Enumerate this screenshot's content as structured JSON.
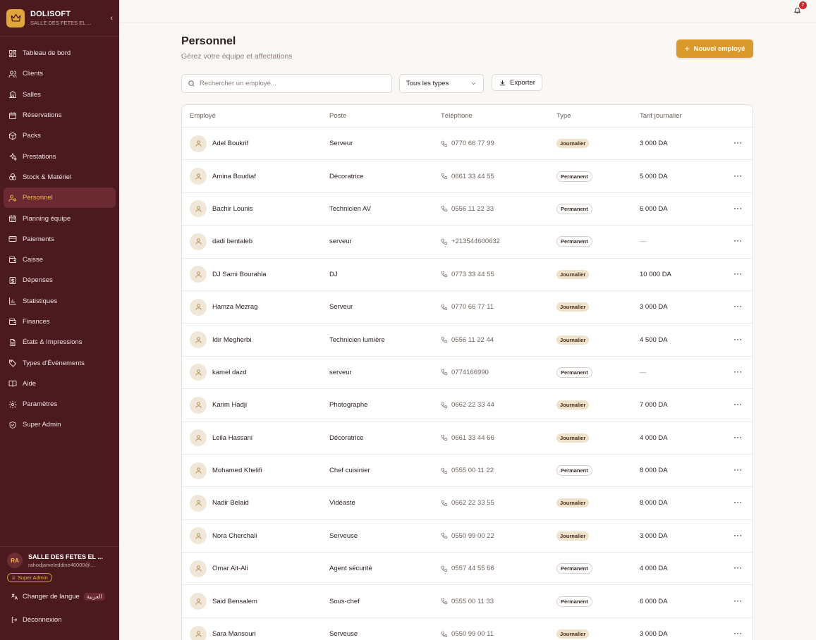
{
  "brand": {
    "name": "DOLISOFT",
    "subtitle": "SALLE DES FETES EL ...",
    "collapse_icon": "chevron-left-icon"
  },
  "nav": [
    {
      "label": "Tableau de bord",
      "icon": "dashboard-icon",
      "active": false
    },
    {
      "label": "Clients",
      "icon": "users-icon",
      "active": false
    },
    {
      "label": "Salles",
      "icon": "building-icon",
      "active": false
    },
    {
      "label": "Réservations",
      "icon": "calendar-icon",
      "active": false
    },
    {
      "label": "Packs",
      "icon": "package-icon",
      "active": false
    },
    {
      "label": "Prestations",
      "icon": "sparkles-icon",
      "active": false
    },
    {
      "label": "Stock & Matériel",
      "icon": "boxes-icon",
      "active": false
    },
    {
      "label": "Personnel",
      "icon": "user-cog-icon",
      "active": true
    },
    {
      "label": "Planning équipe",
      "icon": "calendar-days-icon",
      "active": false
    },
    {
      "label": "Paiements",
      "icon": "credit-card-icon",
      "active": false
    },
    {
      "label": "Caisse",
      "icon": "wallet-icon",
      "active": false
    },
    {
      "label": "Dépenses",
      "icon": "receipt-icon",
      "active": false
    },
    {
      "label": "Statistiques",
      "icon": "bar-chart-icon",
      "active": false
    },
    {
      "label": "Finances",
      "icon": "finance-icon",
      "active": false
    },
    {
      "label": "États & Impressions",
      "icon": "file-text-icon",
      "active": false
    },
    {
      "label": "Types d'Événements",
      "icon": "tag-icon",
      "active": false
    },
    {
      "label": "Aide",
      "icon": "book-icon",
      "active": false
    },
    {
      "label": "Paramètres",
      "icon": "settings-icon",
      "active": false
    },
    {
      "label": "Super Admin",
      "icon": "shield-icon",
      "active": false
    }
  ],
  "account": {
    "initials": "RA",
    "name": "SALLE DES FETES EL ...",
    "email": "rahodjameleddine46000@...",
    "role": "Super Admin"
  },
  "language": {
    "label": "Changer de langue",
    "badge": "العربية"
  },
  "logout_label": "Déconnexion",
  "notifications": {
    "count": "7"
  },
  "page": {
    "title": "Personnel",
    "subtitle": "Gérez votre équipe et affectations",
    "new_button": "Nouvel employé"
  },
  "toolbar": {
    "search_placeholder": "Rechercher un employé...",
    "type_filter": "Tous les types",
    "export_label": "Exporter"
  },
  "table": {
    "headers": [
      "Employé",
      "Poste",
      "Téléphone",
      "Type",
      "Tarif journalier"
    ],
    "rows": [
      {
        "name": "Adel Boukrif",
        "poste": "Serveur",
        "phone": "0770 66 77 99",
        "type": "Journalier",
        "tarif": "3 000 DA"
      },
      {
        "name": "Amina Boudiaf",
        "poste": "Décoratrice",
        "phone": "0661 33 44 55",
        "type": "Permanent",
        "tarif": "5 000 DA"
      },
      {
        "name": "Bachir Lounis",
        "poste": "Technicien AV",
        "phone": "0556 11 22 33",
        "type": "Permanent",
        "tarif": "6 000 DA"
      },
      {
        "name": "dadi bentaleb",
        "poste": "serveur",
        "phone": "+213544600632",
        "type": "Permanent",
        "tarif": "—"
      },
      {
        "name": "DJ Sami Bourahla",
        "poste": "DJ",
        "phone": "0773 33 44 55",
        "type": "Journalier",
        "tarif": "10 000 DA"
      },
      {
        "name": "Hamza Mezrag",
        "poste": "Serveur",
        "phone": "0770 66 77 11",
        "type": "Journalier",
        "tarif": "3 000 DA"
      },
      {
        "name": "Idir Megherbi",
        "poste": "Technicien lumière",
        "phone": "0556 11 22 44",
        "type": "Journalier",
        "tarif": "4 500 DA"
      },
      {
        "name": "kamel dazd",
        "poste": "serveur",
        "phone": "0774166990",
        "type": "Permanent",
        "tarif": "—"
      },
      {
        "name": "Karim Hadji",
        "poste": "Photographe",
        "phone": "0662 22 33 44",
        "type": "Journalier",
        "tarif": "7 000 DA"
      },
      {
        "name": "Leila Hassani",
        "poste": "Décoratrice",
        "phone": "0661 33 44 66",
        "type": "Journalier",
        "tarif": "4 000 DA"
      },
      {
        "name": "Mohamed Khelifi",
        "poste": "Chef cuisinier",
        "phone": "0555 00 11 22",
        "type": "Permanent",
        "tarif": "8 000 DA"
      },
      {
        "name": "Nadir Belaid",
        "poste": "Vidéaste",
        "phone": "0662 22 33 55",
        "type": "Journalier",
        "tarif": "8 000 DA"
      },
      {
        "name": "Nora Cherchali",
        "poste": "Serveuse",
        "phone": "0550 99 00 22",
        "type": "Journalier",
        "tarif": "3 000 DA"
      },
      {
        "name": "Omar Ait-Ali",
        "poste": "Agent sécurité",
        "phone": "0557 44 55 66",
        "type": "Permanent",
        "tarif": "4 000 DA"
      },
      {
        "name": "Said Bensalem",
        "poste": "Sous-chef",
        "phone": "0555 00 11 33",
        "type": "Permanent",
        "tarif": "6 000 DA"
      },
      {
        "name": "Sara Mansouri",
        "poste": "Serveuse",
        "phone": "0550 99 00 11",
        "type": "Journalier",
        "tarif": "3 000 DA"
      }
    ],
    "row_action_icon": "more-horizontal-icon"
  },
  "colors": {
    "sidebar_bg": "#4a1a1f",
    "accent": "#d99a2b",
    "active_item_bg": "#6b2a31",
    "badge_red": "#d8232a"
  }
}
